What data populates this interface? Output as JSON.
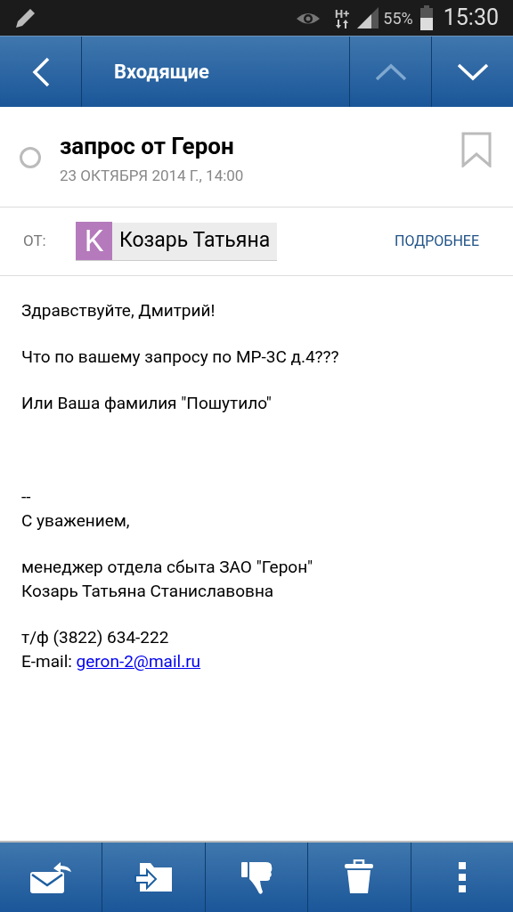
{
  "status_bar": {
    "battery": "55%",
    "time": "15:30",
    "network": "H+"
  },
  "header": {
    "title": "Входящие",
    "nav": [
      {
        "kind": "up",
        "disabled": true
      },
      {
        "kind": "down",
        "disabled": false
      }
    ]
  },
  "message": {
    "subject": "запрос от Герон",
    "date": "23 ОКТЯБРЯ 2014 Г., 14:00",
    "read": false,
    "flagged": false
  },
  "sender": {
    "label": "ОТ:",
    "initial": "K",
    "name": "Козарь Татьяна",
    "color": "#b57abc",
    "details": "ПОДРОБНЕЕ"
  },
  "body": [
    {
      "lines": [
        {
          "text": "Здравствуйте, Дмитрий!"
        }
      ]
    },
    {
      "lines": [
        {
          "text": "Что по вашему запросу по МР-3С д.4???"
        }
      ]
    },
    {
      "lines": [
        {
          "text": "Или Ваша фамилия \"Пошутило\""
        }
      ]
    },
    {
      "lines": [
        {
          "text": "--"
        },
        {
          "text": "С уважением,"
        }
      ]
    },
    {
      "lines": [
        {
          "text": "менеджер отдела сбыта ЗАО \"Герон\""
        },
        {
          "text": "Козарь Татьяна Станиславовна"
        }
      ]
    },
    {
      "lines": [
        {
          "text": "т/ф (3822) 634-222"
        },
        {
          "text": "E-mail: ",
          "link": "geron-2@mail.ru"
        }
      ]
    }
  ],
  "toolbar": [
    {
      "kind": "reply"
    },
    {
      "kind": "move"
    },
    {
      "kind": "spam"
    },
    {
      "kind": "delete"
    },
    {
      "kind": "more"
    }
  ]
}
